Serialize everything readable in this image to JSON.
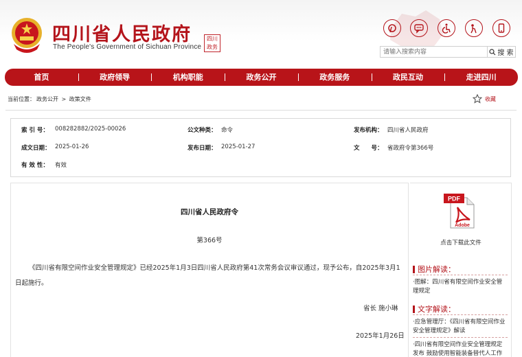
{
  "header": {
    "title": "四川省人民政府",
    "subtitle": "The People's Government of Sichuan Province",
    "icons": [
      "weibo-icon",
      "chat-icon",
      "accessibility-icon",
      "elder-mode-icon",
      "mobile-icon"
    ],
    "search": {
      "placeholder": "请输入搜索内容",
      "button_label": "搜 索"
    }
  },
  "nav": {
    "items": [
      "首页",
      "政府领导",
      "机构职能",
      "政务公开",
      "政务服务",
      "政民互动",
      "走进四川"
    ]
  },
  "breadcrumb": {
    "label": "当前位置：",
    "items": [
      "政务公开",
      "政策文件"
    ],
    "separator": ">"
  },
  "favorite_label": "收藏",
  "meta": {
    "index_key": "索 引 号：",
    "index_val": "008282882/2025-00026",
    "type_key": "公文种类：",
    "type_val": "命令",
    "issuer_key": "发布机构：",
    "issuer_val": "四川省人民政府",
    "created_key": "成文日期：",
    "created_val": "2025-01-26",
    "published_key": "发布日期：",
    "published_val": "2025-01-27",
    "docno_key": "文　　号：",
    "docno_val": "省政府令第366号",
    "validity_key": "有 效 性：",
    "validity_val": "有效"
  },
  "document": {
    "title": "四川省人民政府令",
    "number": "第366号",
    "body": "《四川省有限空间作业安全管理规定》已经2025年1月3日四川省人民政府第41次常务会议审议通过，现予公布，自2025年3月1日起施行。",
    "signer": "省长  施小琳",
    "date": "2025年1月26日"
  },
  "sidebar": {
    "pdf_label": "点击下载此文件",
    "image_section_title": "图片解读：",
    "image_links": [
      "·图解：四川省有限空间作业安全管理规定"
    ],
    "text_section_title": "文字解读：",
    "text_links": [
      "·应急管理厅：《四川省有限空间作业安全管理规定》解读",
      "·四川省有限空间作业安全管理规定发布 鼓励使用智能装备替代人工作业"
    ]
  },
  "colors": {
    "brand_red": "#b4141b",
    "nav_red": "#b81419"
  }
}
